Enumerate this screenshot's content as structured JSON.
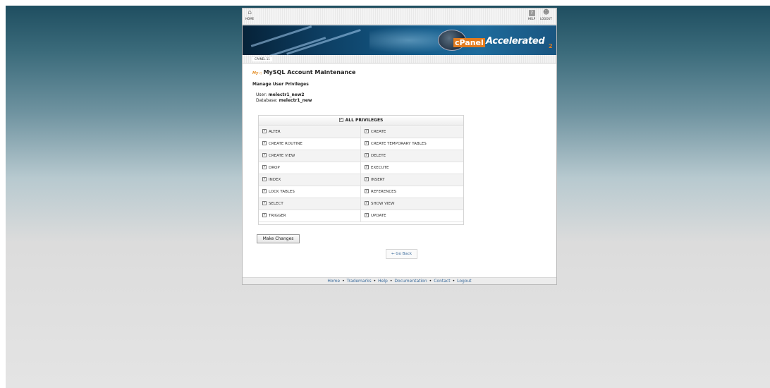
{
  "topbar": {
    "home_label": "HOME",
    "help_label": "HELP",
    "logout_label": "LOGOUT"
  },
  "banner": {
    "brand": "cPanel",
    "product": "Accelerated",
    "version": "2"
  },
  "breadcrumb": "CPANEL 11",
  "page": {
    "heading": "MySQL Account Maintenance",
    "subheading": "Manage User Privileges",
    "user_label": "User:",
    "user_value": "melectr1_new2",
    "database_label": "Database:",
    "database_value": "melectr1_new"
  },
  "privileges": {
    "all_label": "ALL PRIVILEGES",
    "rows": [
      [
        "ALTER",
        "CREATE"
      ],
      [
        "CREATE ROUTINE",
        "CREATE TEMPORARY TABLES"
      ],
      [
        "CREATE VIEW",
        "DELETE"
      ],
      [
        "DROP",
        "EXECUTE"
      ],
      [
        "INDEX",
        "INSERT"
      ],
      [
        "LOCK TABLES",
        "REFERENCES"
      ],
      [
        "SELECT",
        "SHOW VIEW"
      ],
      [
        "TRIGGER",
        "UPDATE"
      ]
    ]
  },
  "actions": {
    "make_changes": "Make Changes",
    "go_back": "← Go Back"
  },
  "footer": [
    "Home",
    "Trademarks",
    "Help",
    "Documentation",
    "Contact",
    "Logout"
  ],
  "colors": {
    "link": "#3b6b9b",
    "accent": "#e37b1e",
    "banner": "#145a88"
  }
}
